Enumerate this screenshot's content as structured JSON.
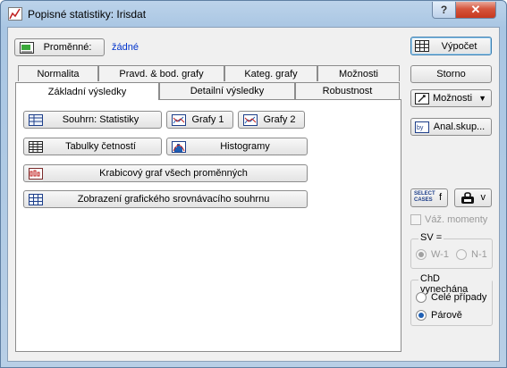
{
  "window": {
    "title": "Popisné statistiky: Irisdat",
    "help_label": "?",
    "close_label": "✕"
  },
  "variables": {
    "button_label": "Proměnné:",
    "value": "žádné"
  },
  "tabs": {
    "row_back": [
      "Normalita",
      "Pravd. & bod. grafy",
      "Kateg. grafy",
      "Možnosti"
    ],
    "row_front": [
      "Základní výsledky",
      "Detailní výsledky",
      "Robustnost"
    ],
    "active": "Základní výsledky"
  },
  "actions": {
    "summary_stats": "Souhrn: Statistiky",
    "graphs1": "Grafy 1",
    "graphs2": "Grafy 2",
    "freq_tables": "Tabulky četností",
    "histograms": "Histogramy",
    "boxplot_all": "Krabicový graf všech proměnných",
    "comparison_summary": "Zobrazení grafického srovnávacího souhrnu"
  },
  "right": {
    "compute": "Výpočet",
    "cancel": "Storno",
    "options": "Možnosti",
    "analysis_group": "Anal.skup...",
    "select_cases_text": "SELECT CASES",
    "select_cases_symbol": "f",
    "weights_symbol": "v",
    "weighted_moments": "Váž. momenty",
    "sv_title": "SV =",
    "sv_options": [
      "W-1",
      "N-1"
    ],
    "sv_selected": "W-1",
    "missing_title": "ChD vynechána",
    "missing_options": [
      "Celé případy",
      "Párově"
    ],
    "missing_selected": "Párově"
  },
  "colors": {
    "link": "#0033cc",
    "titlebar": "#bcd3ea",
    "close": "#c7391f",
    "radio": "#1e5fb4"
  }
}
